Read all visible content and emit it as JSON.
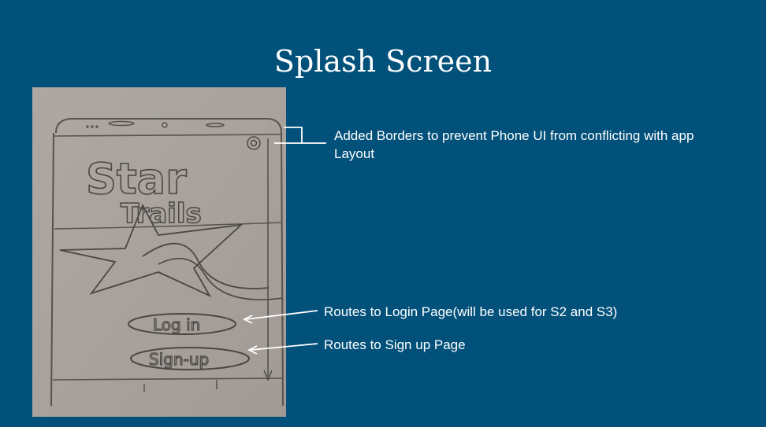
{
  "slide": {
    "title": "Splash Screen"
  },
  "sketch": {
    "app_title_line1": "Star",
    "app_title_line2": "Trails",
    "login_button": "Log in",
    "signup_button": "Sign-up",
    "icon": "settings-gear-icon"
  },
  "annotations": {
    "borders_note": "Added Borders to prevent Phone UI from conflicting with app Layout",
    "login_note": "Routes to Login Page(will be used for S2 and S3)",
    "signup_note": "Routes to Sign up Page"
  },
  "colors": {
    "background": "#02517b",
    "paper": "#a9a29d",
    "pencil": "#4a4744",
    "text": "#ffffff"
  }
}
